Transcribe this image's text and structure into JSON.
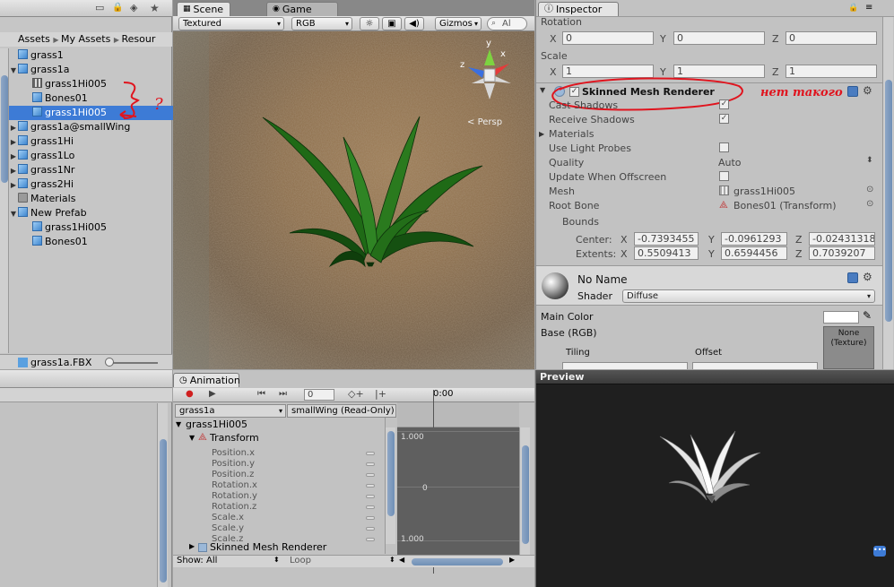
{
  "project": {
    "tab_scene_bar_icons": [
      "lock-icon",
      "menu-icon",
      "tag-icon",
      "star-icon"
    ],
    "breadcrumb": [
      "Assets",
      "My Assets",
      "Resour"
    ],
    "items": [
      {
        "label": "grass1",
        "icon": "prefab-icon",
        "indent": 0,
        "expand": "",
        "selected": false
      },
      {
        "label": "grass1a",
        "icon": "prefab-icon",
        "indent": 0,
        "expand": "down",
        "selected": false
      },
      {
        "label": "grass1Hi005",
        "icon": "mesh-icon",
        "indent": 1,
        "expand": "",
        "selected": false
      },
      {
        "label": "Bones01",
        "icon": "prefab-icon",
        "indent": 1,
        "expand": "",
        "selected": false
      },
      {
        "label": "grass1Hi005",
        "icon": "prefab-icon",
        "indent": 1,
        "expand": "",
        "selected": true
      },
      {
        "label": "grass1a@smallWing",
        "icon": "prefab-icon",
        "indent": 0,
        "expand": "right",
        "selected": false
      },
      {
        "label": "grass1Hi",
        "icon": "prefab-icon",
        "indent": 0,
        "expand": "right",
        "selected": false
      },
      {
        "label": "grass1Lo",
        "icon": "prefab-icon",
        "indent": 0,
        "expand": "right",
        "selected": false
      },
      {
        "label": "grass1Nr",
        "icon": "prefab-icon",
        "indent": 0,
        "expand": "right",
        "selected": false
      },
      {
        "label": "grass2Hi",
        "icon": "prefab-icon",
        "indent": 0,
        "expand": "right",
        "selected": false
      },
      {
        "label": "Materials",
        "icon": "folder-icon",
        "indent": 0,
        "expand": "",
        "selected": false
      },
      {
        "label": "New Prefab",
        "icon": "prefab-icon",
        "indent": 0,
        "expand": "down",
        "selected": false
      },
      {
        "label": "grass1Hi005",
        "icon": "prefab-icon",
        "indent": 1,
        "expand": "",
        "selected": false
      },
      {
        "label": "Bones01",
        "icon": "prefab-icon",
        "indent": 1,
        "expand": "",
        "selected": false
      }
    ],
    "footer_file": "grass1a.FBX",
    "annotation_question": "?"
  },
  "scene": {
    "tab_scene": "Scene",
    "tab_game": "Game",
    "render_mode": "Textured",
    "color_mode": "RGB",
    "gizmos": "Gizmos",
    "search_placeholder": "Al",
    "persp_label": "Persp",
    "axis_y": "y",
    "axis_x": "x",
    "axis_z": "z"
  },
  "inspector": {
    "tab": "Inspector",
    "rotation_label": "Rotation",
    "rotation": {
      "x": "0",
      "y": "0",
      "z": "0"
    },
    "scale_label": "Scale",
    "scale": {
      "x": "1",
      "y": "1",
      "z": "1"
    },
    "axis_x": "X",
    "axis_y": "Y",
    "axis_z": "Z",
    "component_title": "Skinned Mesh Renderer",
    "annotation_text": "нет такого",
    "props": {
      "cast_shadows": "Cast Shadows",
      "receive_shadows": "Receive Shadows",
      "materials": "Materials",
      "use_light_probes": "Use Light Probes",
      "quality": "Quality",
      "quality_value": "Auto",
      "update_offscreen": "Update When Offscreen",
      "mesh": "Mesh",
      "mesh_value": "grass1Hi005",
      "root_bone": "Root Bone",
      "root_bone_value": "Bones01 (Transform)",
      "bounds": "Bounds",
      "center": "Center:",
      "extents": "Extents:"
    },
    "center": {
      "x": "-0.7393455",
      "y": "-0.0961293",
      "z": "-0.02431318"
    },
    "extents": {
      "x": "0.5509413",
      "y": "0.6594456",
      "z": "0.7039207"
    },
    "material_name": "No Name",
    "shader_label": "Shader",
    "shader_value": "Diffuse",
    "main_color": "Main Color",
    "base_rgb": "Base (RGB)",
    "tiling": "Tiling",
    "offset": "Offset",
    "texture_none": "None\n(Texture)"
  },
  "preview": {
    "title": "Preview"
  },
  "animation": {
    "tab": "Animation",
    "frame": "0",
    "time": "0:00",
    "clip_object": "grass1a",
    "clip_name": "smallWing (Read-Only)",
    "root": "grass1Hi005",
    "transform": "Transform",
    "curves": [
      "Position.x",
      "Position.y",
      "Position.z",
      "Rotation.x",
      "Rotation.y",
      "Rotation.z",
      "Scale.x",
      "Scale.y",
      "Scale.z"
    ],
    "skinned": "Skinned Mesh Renderer",
    "show_label": "Show: All",
    "wrap_label": "Loop",
    "grid_labels": [
      "1.000",
      "0",
      "1.000"
    ]
  },
  "colors": {
    "selection": "#3d7bd6",
    "annotation_red": "#e0141e",
    "panel": "#c2c2c2"
  }
}
